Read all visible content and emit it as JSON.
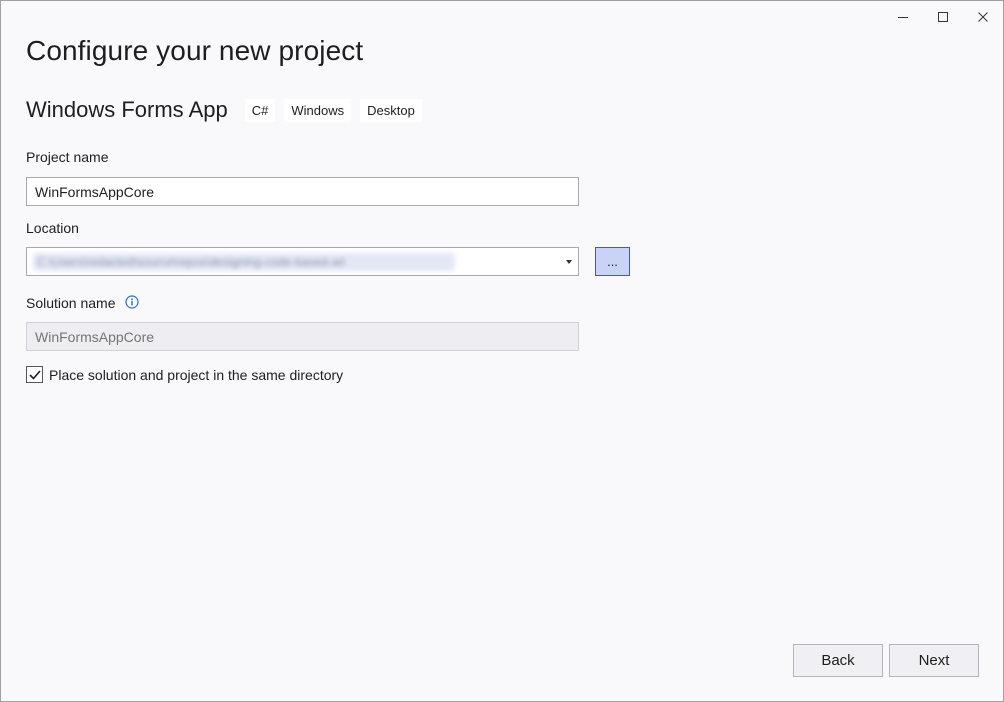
{
  "window": {
    "controls": [
      {
        "icon": "minimize-icon"
      },
      {
        "icon": "maximize-icon"
      },
      {
        "icon": "close-icon"
      }
    ]
  },
  "heading": "Configure your new project",
  "template": {
    "name": "Windows Forms App",
    "tags": [
      "C#",
      "Windows",
      "Desktop"
    ]
  },
  "project_name": {
    "label": "Project name",
    "value": "WinFormsAppCore"
  },
  "location": {
    "label": "Location",
    "value": "C:\\Users\\redacted\\source\\repos\\designing-code-based-ari",
    "browse_label": "..."
  },
  "solution_name": {
    "label": "Solution name",
    "info_icon": "info-icon",
    "placeholder": "WinFormsAppCore",
    "disabled": true
  },
  "same_directory": {
    "label": "Place solution and project in the same directory",
    "checked": true
  },
  "buttons": {
    "back": "Back",
    "next": "Next"
  },
  "colors": {
    "accent": "#3a5bc7",
    "browse_bg": "#c9d3f6",
    "info_icon": "#2f6fc0"
  }
}
